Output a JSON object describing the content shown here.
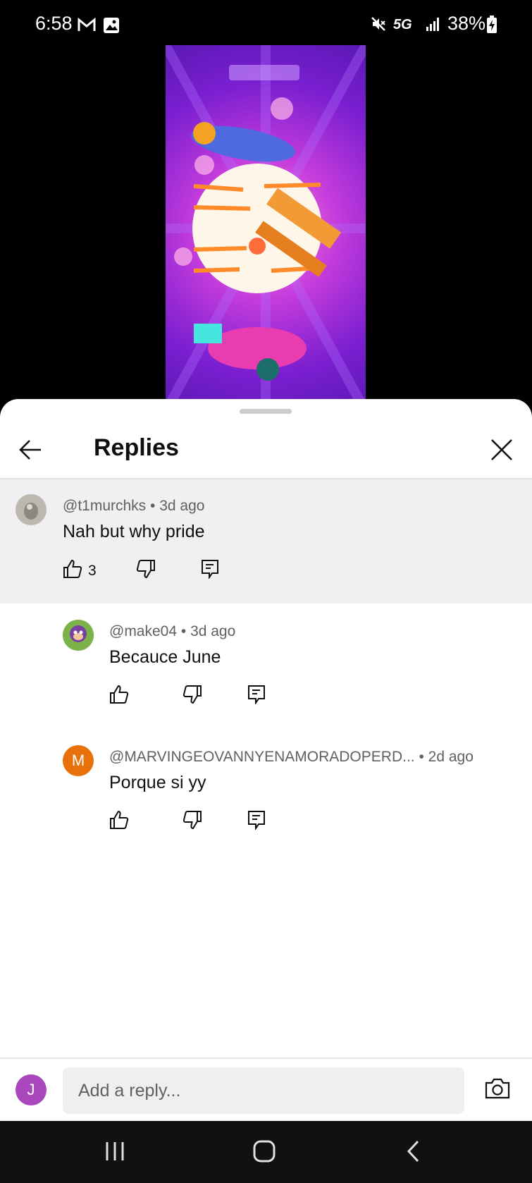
{
  "status_bar": {
    "time": "6:58",
    "network": "5G",
    "battery": "38%",
    "icons": [
      "gmail-icon",
      "photo-icon",
      "mute-icon",
      "signal-icon",
      "battery-charging-icon"
    ]
  },
  "video": {
    "thumbnail_icon": "game-vehicles-thumbnail"
  },
  "header": {
    "title": "Replies",
    "back_icon": "arrow-left-icon",
    "close_icon": "close-icon"
  },
  "parent_comment": {
    "author": "@t1murchks",
    "time": "3d ago",
    "text": "Nah but why pride",
    "likes": "3"
  },
  "replies": [
    {
      "author": "@make04",
      "time": "3d ago",
      "text": "Becauce June"
    },
    {
      "author": "@MARVINGEOVANNYENAMORADOPERD...",
      "time": "2d ago",
      "text": "Porque si yy",
      "avatar_letter": "M",
      "avatar_color": "#e8710a"
    }
  ],
  "reply_bar": {
    "user_initial": "J",
    "user_color": "#ab47bc",
    "placeholder": "Add a reply..."
  },
  "meta_separator": " • "
}
